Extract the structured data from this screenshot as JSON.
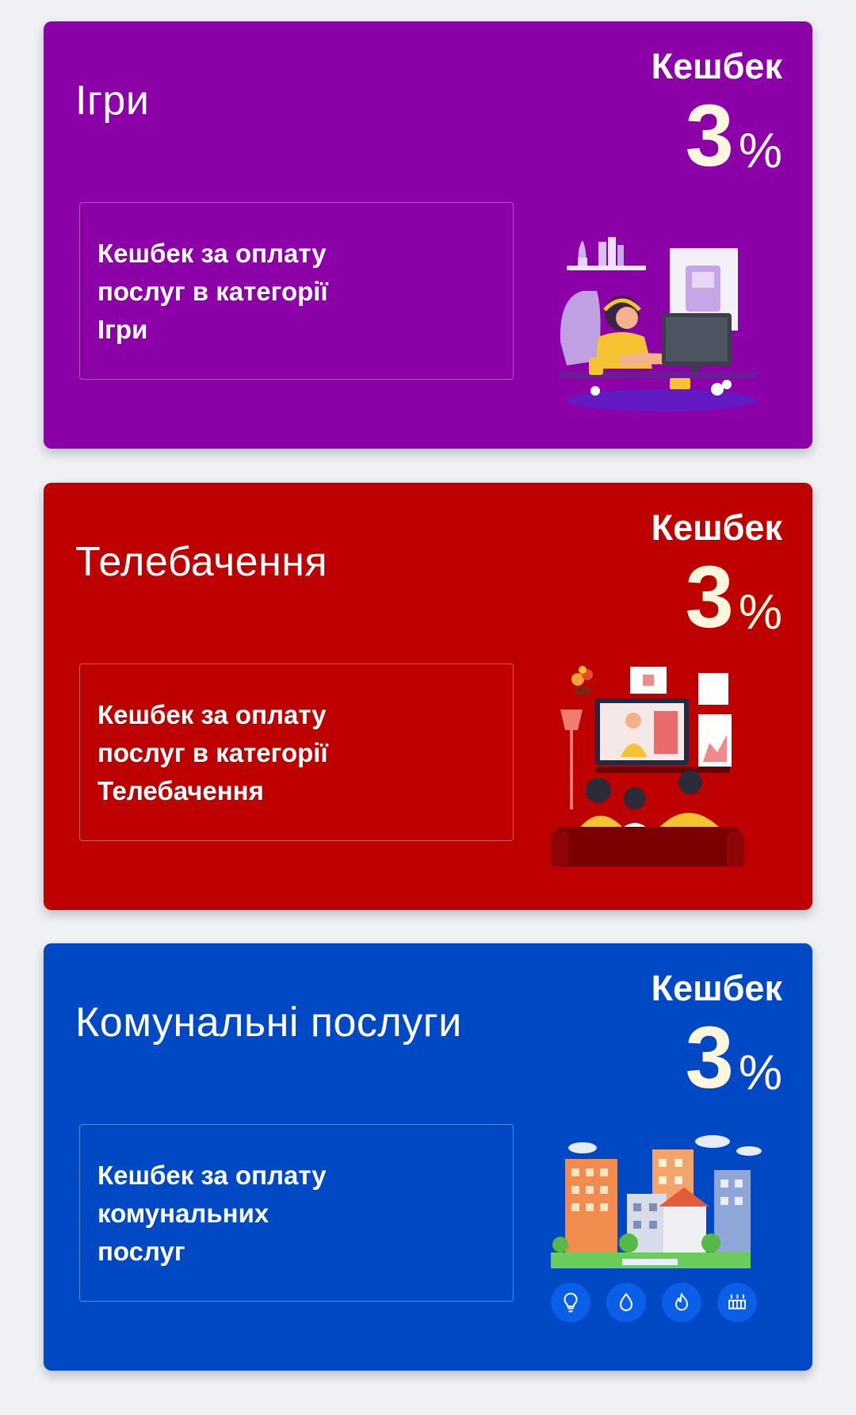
{
  "cards": [
    {
      "title": "Ігри",
      "cashback_label": "Кешбек",
      "cashback_value": "3",
      "cashback_unit": "%",
      "description": [
        "Кешбек за оплату",
        "послуг в категорії",
        "Ігри"
      ],
      "color": "#8b00a7"
    },
    {
      "title": "Телебачення",
      "cashback_label": "Кешбек",
      "cashback_value": "3",
      "cashback_unit": "%",
      "description": [
        "Кешбек за оплату",
        "послуг в категорії",
        "Телебачення"
      ],
      "color": "#bd0000"
    },
    {
      "title": "Комунальні послуги",
      "cashback_label": "Кешбек",
      "cashback_value": "3",
      "cashback_unit": "%",
      "description": [
        "Кешбек за оплату",
        "комунальних",
        "послуг"
      ],
      "color": "#0048c4",
      "utility_icons": [
        "lightbulb-icon",
        "water-drop-icon",
        "gas-flame-icon",
        "radiator-icon"
      ]
    }
  ]
}
